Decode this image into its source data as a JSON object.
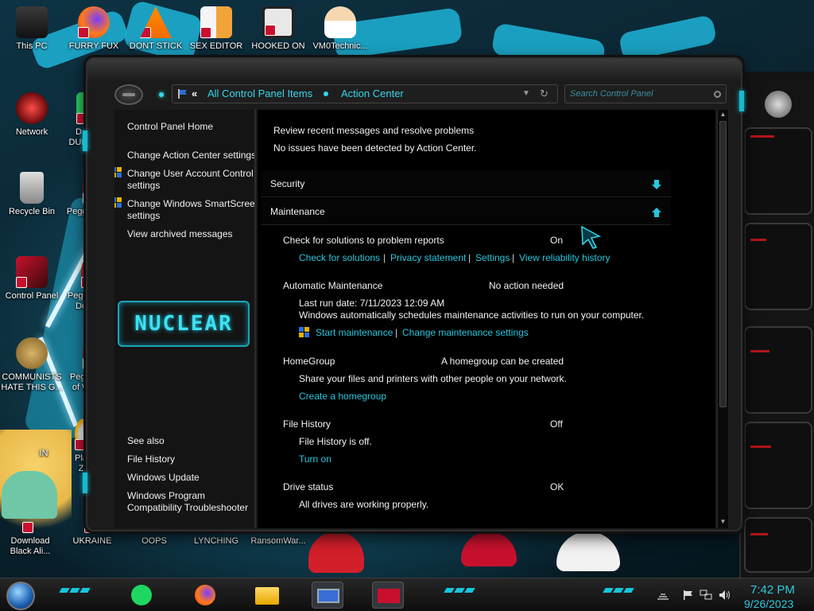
{
  "desktop": {
    "icons": [
      {
        "label": "This PC"
      },
      {
        "label": "FURRY FUX"
      },
      {
        "label": "DONT STICK"
      },
      {
        "label": "SEX EDITOR"
      },
      {
        "label": "HOOKED ON"
      },
      {
        "label": "VM0Technic..."
      },
      {
        "label": "Network"
      },
      {
        "label": "D\nDUM"
      },
      {
        "label": "Recycle Bin"
      },
      {
        "label": "Peggle"
      },
      {
        "label": "Control Panel"
      },
      {
        "label": "Peggle\nDe"
      },
      {
        "label": "COMMUNISTS\nHATE THIS G..."
      },
      {
        "label": "Peggle\nof Wa"
      },
      {
        "label": "IN"
      },
      {
        "label": "Plan\nZo"
      },
      {
        "label": "Download\nBlack Ali..."
      },
      {
        "label": "UKRAINE"
      },
      {
        "label": "OOPS"
      },
      {
        "label": "LYNCHING"
      },
      {
        "label": "RansomWar..."
      }
    ]
  },
  "window": {
    "breadcrumb": {
      "prefix": "«",
      "item1": "All Control Panel Items",
      "item2": "Action Center"
    },
    "search_placeholder": "Search Control Panel",
    "left_pane": {
      "links": [
        "Control Panel Home",
        "Change Action Center settings",
        "Change User Account Control settings",
        "Change Windows SmartScreen settings",
        "View archived messages"
      ],
      "logo_text": "NUCLEAR",
      "see_also_heading": "See also",
      "see_also": [
        "File History",
        "Windows Update",
        "Windows Program Compatibility Troubleshooter"
      ]
    },
    "content": {
      "intro_title": "Review recent messages and resolve problems",
      "intro_status": "No issues have been detected by Action Center.",
      "security_section": "Security",
      "maintenance_section": "Maintenance",
      "problem_reports": {
        "title": "Check for solutions to problem reports",
        "status": "On",
        "links": [
          "Check for solutions",
          "Privacy statement",
          "Settings",
          "View reliability history"
        ],
        "separator": "|"
      },
      "auto_maintenance": {
        "title": "Automatic Maintenance",
        "status": "No action needed",
        "last_run": "Last run date: 7/11/2023 12:09 AM",
        "description": "Windows automatically schedules maintenance activities to run on your computer.",
        "link1": "Start maintenance",
        "link2": "Change maintenance settings"
      },
      "homegroup": {
        "title": "HomeGroup",
        "status": "A homegroup can be created",
        "description": "Share your files and printers with other people on your network.",
        "link": "Create a homegroup"
      },
      "file_history": {
        "title": "File History",
        "status": "Off",
        "description": "File History is off.",
        "link": "Turn on"
      },
      "drive_status": {
        "title": "Drive status",
        "status": "OK",
        "description": "All drives are working properly."
      }
    }
  },
  "taskbar": {
    "time": "7:42 PM",
    "date": "9/26/2023"
  },
  "colors": {
    "accent": "#27c7dd",
    "window_bg": "#000000",
    "frame": "#1b1b1b"
  }
}
